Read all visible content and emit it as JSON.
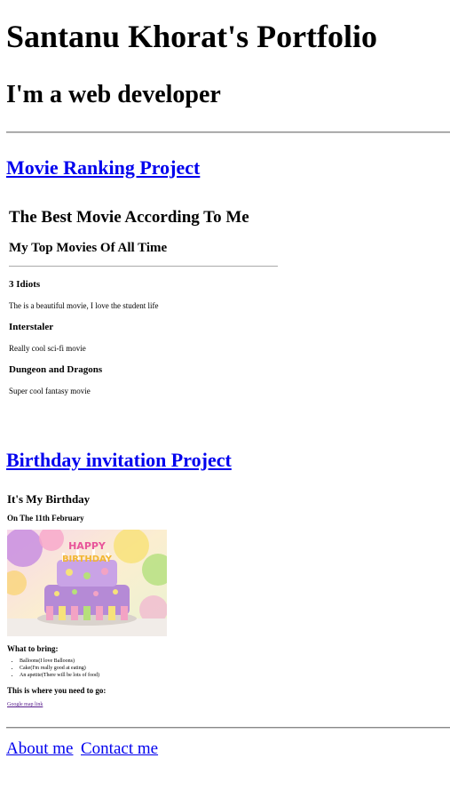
{
  "header": {
    "title": "Santanu Khorat's Portfolio",
    "subtitle": "I'm a web developer"
  },
  "projects": {
    "movie": {
      "link": "Movie Ranking Project",
      "title": "The Best Movie According To Me",
      "subtitle": "My Top Movies Of All Time",
      "movies": [
        {
          "name": "3 Idiots",
          "desc": "The is a beautiful movie, I love the student life"
        },
        {
          "name": "Interstaler",
          "desc": "Really cool sci-fi movie"
        },
        {
          "name": "Dungeon and Dragons",
          "desc": "Super cool fantasy movie"
        }
      ]
    },
    "birthday": {
      "link": "Birthday invitation Project",
      "title": "It's My Birthday",
      "date": "On The 11th February",
      "bring_heading": "What to bring:",
      "items": [
        "Balloons(I love Balloons)",
        "Cake(I'm really good at eating)",
        "An apetite(There will be lots of food)"
      ],
      "where_heading": "This is where you need to go:",
      "map_link": "Google map link",
      "image_text": "HAPPY BIRTHDAY"
    }
  },
  "footer": {
    "about": "About me",
    "contact": "Contact me"
  }
}
